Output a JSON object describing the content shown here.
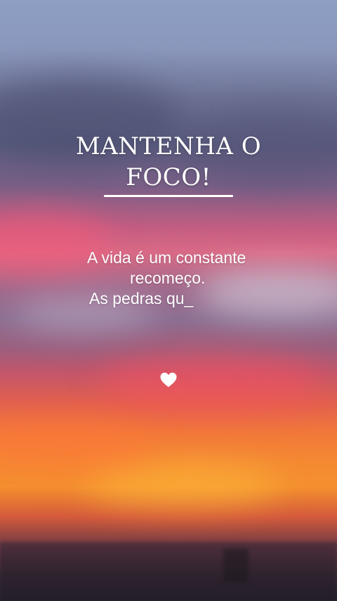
{
  "heading": {
    "line1": "MANTENHA O",
    "line2": "FOCO!"
  },
  "quote": {
    "line1": "A vida é um constante",
    "line2": "recomeço.",
    "line3": "As pedras qu_"
  },
  "icons": {
    "heart": "heart-icon"
  },
  "colors": {
    "text": "#ffffff",
    "sky_top": "#8e9ec4",
    "sunset_orange": "#f48a32",
    "sunset_pink": "#d96a86"
  }
}
